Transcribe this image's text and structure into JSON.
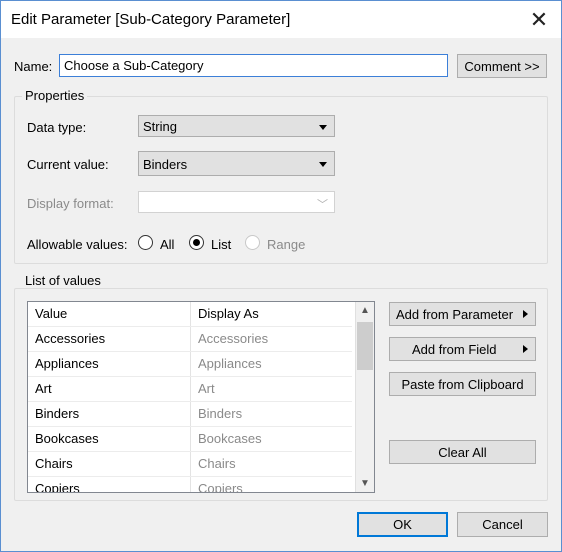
{
  "window": {
    "title": "Edit Parameter [Sub-Category Parameter]"
  },
  "name_row": {
    "label": "Name:",
    "value": "Choose a Sub-Category",
    "comment_button": "Comment >>"
  },
  "properties": {
    "title": "Properties",
    "data_type_label": "Data type:",
    "data_type_value": "String",
    "current_value_label": "Current value:",
    "current_value_value": "Binders",
    "display_format_label": "Display format:",
    "display_format_value": "",
    "allowable_label": "Allowable values:",
    "allowable_options": [
      {
        "label": "All",
        "checked": false,
        "enabled": true
      },
      {
        "label": "List",
        "checked": true,
        "enabled": true
      },
      {
        "label": "Range",
        "checked": false,
        "enabled": false
      }
    ]
  },
  "list_of_values": {
    "title": "List of values",
    "columns": [
      "Value",
      "Display As"
    ],
    "rows": [
      {
        "value": "Accessories",
        "display": "Accessories"
      },
      {
        "value": "Appliances",
        "display": "Appliances"
      },
      {
        "value": "Art",
        "display": "Art"
      },
      {
        "value": "Binders",
        "display": "Binders"
      },
      {
        "value": "Bookcases",
        "display": "Bookcases"
      },
      {
        "value": "Chairs",
        "display": "Chairs"
      },
      {
        "value": "Copiers",
        "display": "Copiers"
      }
    ],
    "buttons": {
      "add_from_parameter": "Add from Parameter",
      "add_from_field": "Add from Field",
      "paste_from_clipboard": "Paste from Clipboard",
      "clear_all": "Clear All"
    }
  },
  "footer": {
    "ok": "OK",
    "cancel": "Cancel"
  },
  "colors": {
    "accent": "#0078d7",
    "window_border": "#5a8fd1",
    "dialog_bg": "#f0f0f0"
  }
}
